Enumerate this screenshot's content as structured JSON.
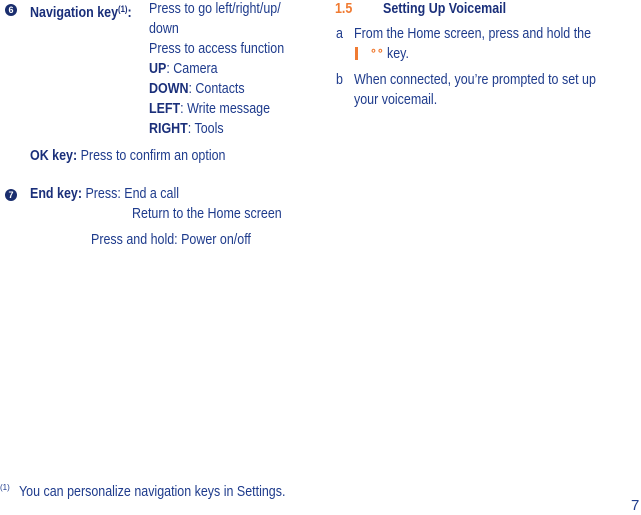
{
  "left_column": {
    "item6": {
      "bullet": "6",
      "label": "Navigation key",
      "footnote_ref": "(1)",
      "colon": ":",
      "lines": [
        "Press to go left/right/up/",
        "down",
        "Press to access function"
      ],
      "functions": [
        {
          "key": "UP",
          "action": ": Camera"
        },
        {
          "key": "DOWN",
          "action": ": Contacts"
        },
        {
          "key": "LEFT",
          "action": ": Write message"
        },
        {
          "key": "RIGHT",
          "action": ": Tools"
        }
      ]
    },
    "ok_key": {
      "label": "OK key:",
      "text": " Press to confirm an option"
    },
    "item7": {
      "bullet": "7",
      "label": "End key:",
      "press_label": " Press: End a call",
      "press_line2": "Return to the Home screen",
      "hold_line": "Press and hold: Power on/off"
    }
  },
  "right_column": {
    "section_number": "1.5",
    "section_title": "Setting Up Voicemail",
    "steps": [
      {
        "letter": "a",
        "line1": "From the Home screen, press and hold the",
        "line2": "key.",
        "icon": "voicemail-icon"
      },
      {
        "letter": "b",
        "line1": "When connected, you’re prompted to set up",
        "line2": "your voicemail."
      }
    ]
  },
  "footnote": {
    "mark": "(1)",
    "text": "You can personalize navigation keys in Settings."
  },
  "page_number": "7",
  "colors": {
    "text": "#1e3b8c",
    "accent": "#f07b32"
  }
}
